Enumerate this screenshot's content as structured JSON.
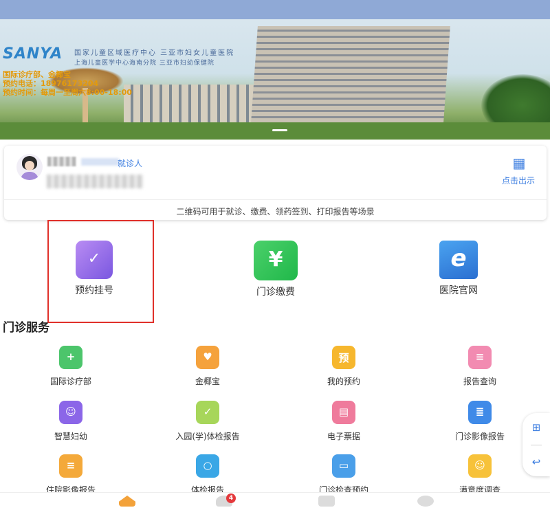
{
  "banner": {
    "logo": "SANYA",
    "hospital_line1": "国家儿童区域医疗中心 三亚市妇女儿童医院",
    "hospital_line2": "上海儿童医学中心海南分院 三亚市妇幼保健院",
    "info_dept": "国际诊疗部、金椰宝",
    "info_phone": "预约电话：18976173204",
    "info_time": "预约时间：每周一至周六8:00-18:00"
  },
  "patient_card": {
    "tag": "就诊人",
    "qr_label": "点击出示",
    "hint": "二维码可用于就诊、缴费、领药签到、打印报告等场景"
  },
  "quick_actions": [
    {
      "label": "预约挂号",
      "icon": "calendar-check-icon"
    },
    {
      "label": "门诊缴费",
      "icon": "yuan-ticket-icon"
    },
    {
      "label": "医院官网",
      "icon": "hospital-web-icon"
    }
  ],
  "section": {
    "title": "门诊服务"
  },
  "services": [
    {
      "label": "国际诊疗部",
      "icon": "medical-kit-icon"
    },
    {
      "label": "金椰宝",
      "icon": "home-heart-icon"
    },
    {
      "label": "我的预约",
      "icon": "appointment-doc-icon",
      "sym": "预"
    },
    {
      "label": "报告查询",
      "icon": "report-search-icon"
    },
    {
      "label": "智慧妇幼",
      "icon": "robot-icon"
    },
    {
      "label": "入园(学)体检报告",
      "icon": "checkup-clipboard-icon"
    },
    {
      "label": "电子票据",
      "icon": "e-ticket-icon"
    },
    {
      "label": "门诊影像报告",
      "icon": "imaging-report-icon"
    },
    {
      "label": "住院影像报告",
      "icon": "inpatient-imaging-icon"
    },
    {
      "label": "体检报告",
      "icon": "checkup-search-icon"
    },
    {
      "label": "门诊检查预约",
      "icon": "exam-booking-icon"
    },
    {
      "label": "满意度调查",
      "icon": "smile-survey-icon"
    }
  ],
  "tabbar": {
    "tabs": [
      {
        "name": "home",
        "icon": "home-icon"
      },
      {
        "name": "messages",
        "icon": "chat-icon",
        "badge": "4"
      },
      {
        "name": "records",
        "icon": "list-icon"
      },
      {
        "name": "profile",
        "icon": "cloud-icon"
      }
    ]
  },
  "colors": {
    "accent": "#3b7de0",
    "highlight_border": "#e0302a",
    "badge": "#e4393c"
  }
}
